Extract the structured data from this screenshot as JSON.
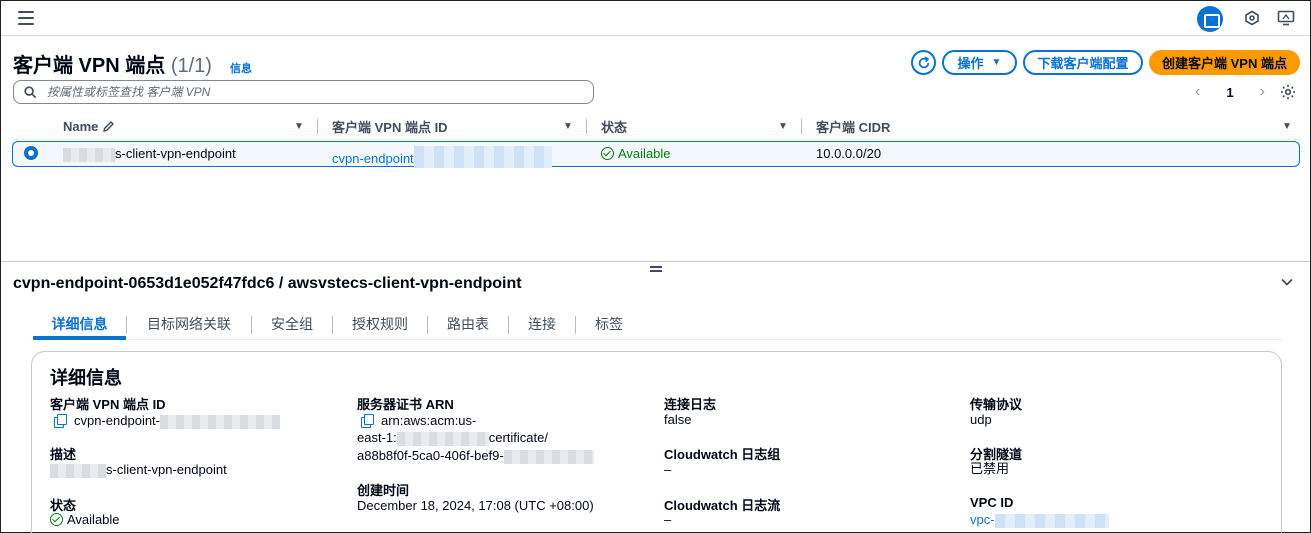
{
  "topbar": {
    "menu_icon": "hamburger-menu-icon",
    "right_icons": [
      "split-panel-icon",
      "security-icon",
      "monitor-icon"
    ]
  },
  "header": {
    "title": "客户端 VPN 端点",
    "count": "(1/1)",
    "info": "信息",
    "actions_label": "操作",
    "download_label": "下载客户端配置",
    "create_label": "创建客户端 VPN 端点"
  },
  "search": {
    "placeholder": "按属性或标签查找 客户端 VPN"
  },
  "pagination": {
    "current_page": "1"
  },
  "table": {
    "columns": [
      "Name",
      "客户端 VPN 端点 ID",
      "状态",
      "客户端 CIDR"
    ],
    "rows": [
      {
        "name_suffix": "s-client-vpn-endpoint",
        "id_prefix": "cvpn-endpoint",
        "status": "Available",
        "cidr": "10.0.0.0/20"
      }
    ]
  },
  "detail": {
    "title": "cvpn-endpoint-0653d1e052f47fdc6 / awsvstecs-client-vpn-endpoint",
    "tabs": [
      "详细信息",
      "目标网络关联",
      "安全组",
      "授权规则",
      "路由表",
      "连接",
      "标签"
    ],
    "card_title": "详细信息",
    "fields": {
      "endpoint_id_label": "客户端 VPN 端点 ID",
      "endpoint_id_value": "cvpn-endpoint-",
      "desc_label": "描述",
      "desc_value": "s-client-vpn-endpoint",
      "status_label": "状态",
      "status_value": "Available",
      "arn_label": "服务器证书 ARN",
      "arn_line1": "arn:aws:acm:us-",
      "arn_line2_a": "east-1:",
      "arn_line2_b": "certificate/",
      "arn_line3": "a88b8f0f-5ca0-406f-bef9-",
      "created_label": "创建时间",
      "created_value": "December 18, 2024, 17:08 (UTC +08:00)",
      "conn_log_label": "连接日志",
      "conn_log_value": "false",
      "cw_group_label": "Cloudwatch 日志组",
      "cw_group_value": "–",
      "cw_stream_label": "Cloudwatch 日志流",
      "cw_stream_value": "–",
      "transport_label": "传输协议",
      "transport_value": "udp",
      "split_label": "分割隧道",
      "split_value": "已禁用",
      "vpc_label": "VPC ID",
      "vpc_value": "vpc-"
    }
  },
  "colors": {
    "primary": "#0972d3",
    "create_button": "#ff9900",
    "success": "#037f0c"
  }
}
